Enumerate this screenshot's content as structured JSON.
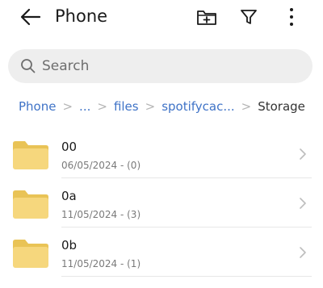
{
  "header": {
    "title": "Phone",
    "icons": [
      "back-arrow-icon",
      "new-folder-icon",
      "filter-icon",
      "more-vertical-icon"
    ]
  },
  "search": {
    "placeholder": "Search",
    "value": ""
  },
  "breadcrumb": {
    "items": [
      "Phone",
      "...",
      "files",
      "spotifycac...",
      "Storage"
    ],
    "separator": ">"
  },
  "files": [
    {
      "name": "00",
      "meta": "06/05/2024 - (0)"
    },
    {
      "name": "0a",
      "meta": "11/05/2024 - (3)"
    },
    {
      "name": "0b",
      "meta": "11/05/2024 - (1)"
    }
  ],
  "colors": {
    "accent": "#3f73c7",
    "folder": "#f6d77d",
    "folder_tab": "#e9c356",
    "search_bg": "#eeeeee"
  }
}
